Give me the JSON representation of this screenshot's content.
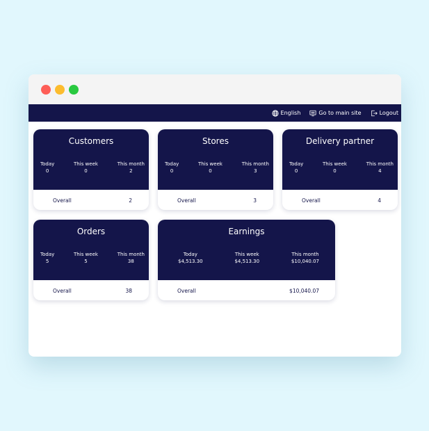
{
  "nav": {
    "language": "English",
    "main_site": "Go to main site",
    "logout": "Logout"
  },
  "colors": {
    "navy": "#14154a",
    "background": "#e1f7fd",
    "dot_red": "#fe5e57",
    "dot_yellow": "#fcbc2e",
    "dot_green": "#29c940"
  },
  "icons": {
    "language": "globe-icon",
    "main_site": "monitor-icon",
    "logout": "logout-icon"
  },
  "cards": [
    {
      "title": "Customers",
      "stats": [
        {
          "label": "Today",
          "value": "0"
        },
        {
          "label": "This week",
          "value": "0"
        },
        {
          "label": "This month",
          "value": "2"
        }
      ],
      "overall_label": "Overall",
      "overall_value": "2"
    },
    {
      "title": "Stores",
      "stats": [
        {
          "label": "Today",
          "value": "0"
        },
        {
          "label": "This week",
          "value": "0"
        },
        {
          "label": "This month",
          "value": "3"
        }
      ],
      "overall_label": "Overall",
      "overall_value": "3"
    },
    {
      "title": "Delivery partner",
      "stats": [
        {
          "label": "Today",
          "value": "0"
        },
        {
          "label": "This week",
          "value": "0"
        },
        {
          "label": "This month",
          "value": "4"
        }
      ],
      "overall_label": "Overall",
      "overall_value": "4"
    },
    {
      "title": "Orders",
      "stats": [
        {
          "label": "Today",
          "value": "5"
        },
        {
          "label": "This week",
          "value": "5"
        },
        {
          "label": "This month",
          "value": "38"
        }
      ],
      "overall_label": "Overall",
      "overall_value": "38"
    },
    {
      "title": "Earnings",
      "stats": [
        {
          "label": "Today",
          "value": "$4,513.30"
        },
        {
          "label": "This week",
          "value": "$4,513.30"
        },
        {
          "label": "This month",
          "value": "$10,040.07"
        }
      ],
      "overall_label": "Overall",
      "overall_value": "$10,040.07"
    }
  ]
}
